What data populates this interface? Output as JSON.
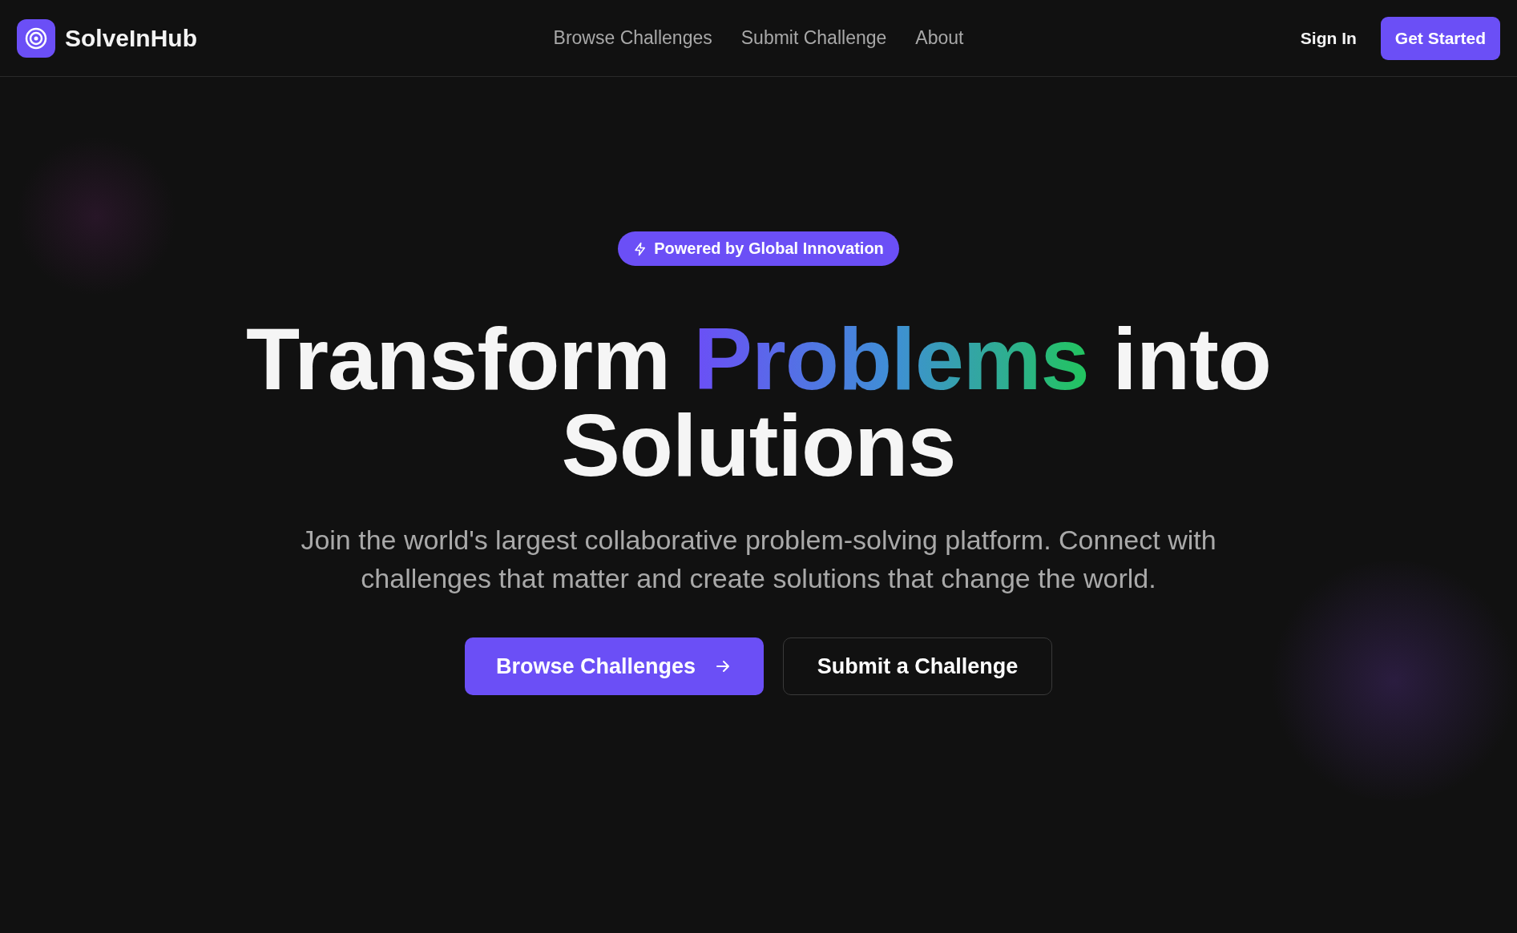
{
  "brand": {
    "name": "SolveInHub"
  },
  "nav": {
    "links": [
      {
        "label": "Browse Challenges"
      },
      {
        "label": "Submit Challenge"
      },
      {
        "label": "About"
      }
    ],
    "sign_in": "Sign In",
    "get_started": "Get Started"
  },
  "hero": {
    "badge": "Powered by Global Innovation",
    "headline": {
      "before": "Transform ",
      "highlight": "Problems",
      "after": " into Solutions"
    },
    "subtitle": "Join the world's largest collaborative problem-solving platform. Connect with challenges that matter and create solutions that change the world.",
    "buttons": [
      {
        "label": "Browse Challenges",
        "kind": "primary"
      },
      {
        "label": "Submit a Challenge",
        "kind": "outline"
      }
    ]
  }
}
